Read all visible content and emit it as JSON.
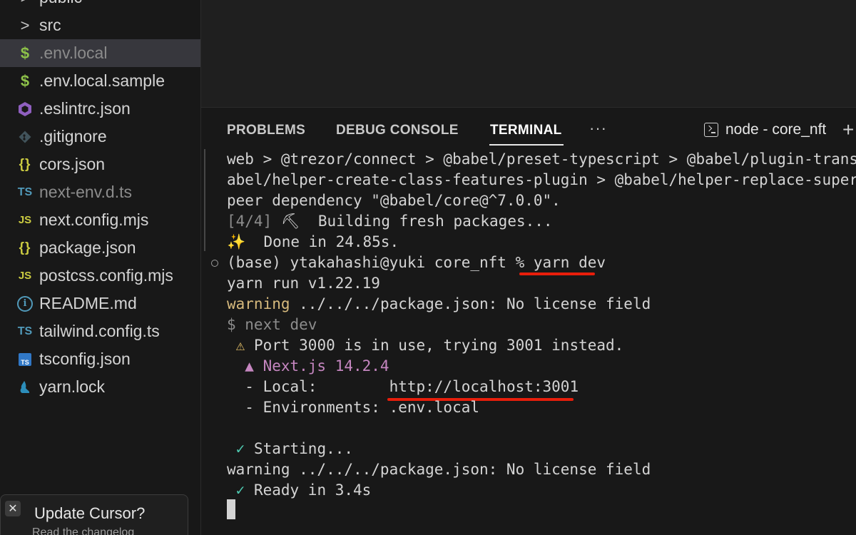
{
  "sidebar": {
    "items": [
      {
        "icon": "chevron-right-icon",
        "glyph": ">",
        "label": "public"
      },
      {
        "icon": "chevron-right-icon",
        "glyph": ">",
        "label": "src"
      },
      {
        "icon": "dollar-icon",
        "glyph": "$",
        "label": ".env.local",
        "selected": true
      },
      {
        "icon": "dollar-icon",
        "glyph": "$",
        "label": ".env.local.sample"
      },
      {
        "icon": "eslint-icon",
        "glyph": "",
        "label": ".eslintrc.json"
      },
      {
        "icon": "git-icon",
        "glyph": "",
        "label": ".gitignore"
      },
      {
        "icon": "braces-icon",
        "glyph": "{}",
        "label": "cors.json"
      },
      {
        "icon": "typescript-icon",
        "glyph": "TS",
        "label": "next-env.d.ts"
      },
      {
        "icon": "javascript-icon",
        "glyph": "JS",
        "label": "next.config.mjs"
      },
      {
        "icon": "braces-icon",
        "glyph": "{}",
        "label": "package.json"
      },
      {
        "icon": "javascript-icon",
        "glyph": "JS",
        "label": "postcss.config.mjs"
      },
      {
        "icon": "info-icon",
        "glyph": "i",
        "label": "README.md"
      },
      {
        "icon": "typescript-icon",
        "glyph": "TS",
        "label": "tailwind.config.ts"
      },
      {
        "icon": "tsconfig-icon",
        "glyph": "TS",
        "label": "tsconfig.json"
      },
      {
        "icon": "yarn-icon",
        "glyph": "",
        "label": "yarn.lock"
      }
    ]
  },
  "toast": {
    "close_glyph": "✕",
    "title": "Update Cursor?",
    "subtitle": "Read the changelog"
  },
  "panel": {
    "tabs": [
      "PROBLEMS",
      "DEBUG CONSOLE",
      "TERMINAL"
    ],
    "active_tab": "TERMINAL",
    "more_glyph": "···",
    "terminal_name": "node - core_nft",
    "add_glyph": "+"
  },
  "terminal": {
    "lines": [
      "web > @trezor/connect > @babel/preset-typescript > @babel/plugin-trans-",
      "abel/helper-create-class-features-plugin > @babel/helper-replace-supers",
      "peer dependency \"@babel/core@^7.0.0\".",
      "[4/4] ⛏  Building fresh packages...",
      "✨  Done in 24.85s.",
      "(base) ytakahashi@yuki core_nft % yarn dev",
      "yarn run v1.22.19",
      "warning ../../../package.json: No license field",
      "$ next dev",
      " ⚠ Port 3000 is in use, trying 3001 instead.",
      "  ▲ Next.js 14.2.4",
      "  - Local:        http://localhost:3001",
      "  - Environments: .env.local",
      "",
      " ✓ Starting...",
      "warning ../../../package.json: No license field",
      " ✓ Ready in 3.4s"
    ],
    "seg": {
      "step": "[4/4]",
      "hammer": " ⛏  ",
      "building": "Building fresh packages...",
      "sparkle": "✨",
      "done": "  Done in 24.85s.",
      "prompt": "(base) ytakahashi@yuki core_nft % ",
      "cmd": "yarn dev",
      "warning": "warning",
      "warn_rest": " ../../../package.json: No license field",
      "dollar_cmd": "$ next dev",
      "warn_icon": " ⚠",
      "port_msg": " Port 3000 is in use, trying 3001 instead.",
      "next": "  ▲ Next.js 14.2.4",
      "local_label": "  - Local:        ",
      "local_url": "http://localhost:3001",
      "env": "  - Environments: .env.local",
      "check": " ✓",
      "starting": " Starting...",
      "ready": " Ready in 3.4s"
    }
  },
  "colors": {
    "highlight_underline": "#e81e0b",
    "warning_yellow": "#d7ba7d",
    "next_purple": "#c586c0",
    "check_green": "#4ec9b0"
  }
}
